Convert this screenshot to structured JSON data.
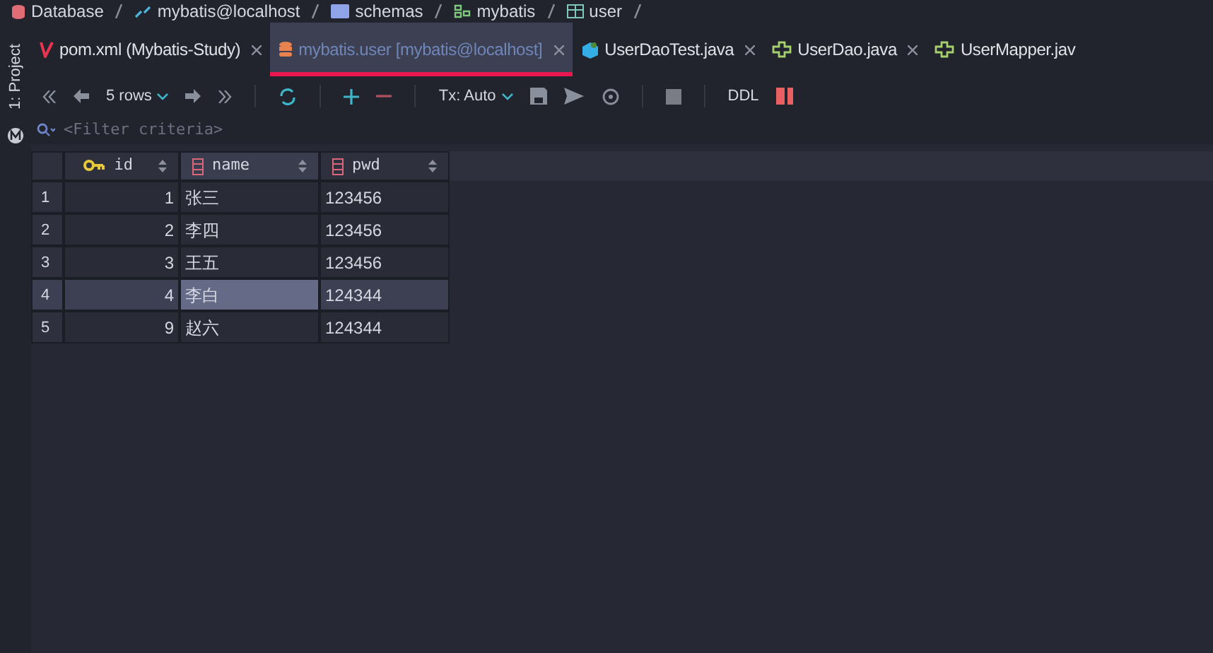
{
  "breadcrumb": [
    {
      "kind": "database",
      "label": "Database"
    },
    {
      "kind": "connection",
      "label": "mybatis@localhost"
    },
    {
      "kind": "folder",
      "label": "schemas"
    },
    {
      "kind": "schema",
      "label": "mybatis"
    },
    {
      "kind": "table",
      "label": "user"
    }
  ],
  "side_panel": {
    "label": "1: Project"
  },
  "tabs": [
    {
      "kind": "maven",
      "label": "pom.xml (Mybatis-Study)",
      "selected": false
    },
    {
      "kind": "database",
      "label": "mybatis.user [mybatis@localhost]",
      "selected": true
    },
    {
      "kind": "test",
      "label": "UserDaoTest.java",
      "selected": false
    },
    {
      "kind": "interface",
      "label": "UserDao.java",
      "selected": false
    },
    {
      "kind": "interface",
      "label": "UserMapper.jav",
      "selected": false
    }
  ],
  "toolbar": {
    "rows": "5 rows",
    "tx": "Tx: Auto",
    "ddl": "DDL"
  },
  "filter": {
    "placeholder": "<Filter criteria>"
  },
  "table": {
    "columns": [
      {
        "kind": "key",
        "label": "id"
      },
      {
        "kind": "column",
        "label": "name"
      },
      {
        "kind": "column",
        "label": "pwd"
      }
    ],
    "rows": [
      {
        "number": "1",
        "selected": false,
        "cells": [
          {
            "text": "1",
            "selected": false
          },
          {
            "text": "张三",
            "selected": false
          },
          {
            "text": "123456",
            "selected": false
          }
        ]
      },
      {
        "number": "2",
        "selected": false,
        "cells": [
          {
            "text": "2",
            "selected": false
          },
          {
            "text": "李四",
            "selected": false
          },
          {
            "text": "123456",
            "selected": false
          }
        ]
      },
      {
        "number": "3",
        "selected": false,
        "cells": [
          {
            "text": "3",
            "selected": false
          },
          {
            "text": "王五",
            "selected": false
          },
          {
            "text": "123456",
            "selected": false
          }
        ]
      },
      {
        "number": "4",
        "selected": true,
        "cells": [
          {
            "text": "4",
            "selected": false
          },
          {
            "text": "李白",
            "selected": true
          },
          {
            "text": "124344",
            "selected": false
          }
        ]
      },
      {
        "number": "5",
        "selected": false,
        "cells": [
          {
            "text": "9",
            "selected": false
          },
          {
            "text": "赵六",
            "selected": false
          },
          {
            "text": "124344",
            "selected": false
          }
        ]
      }
    ]
  }
}
